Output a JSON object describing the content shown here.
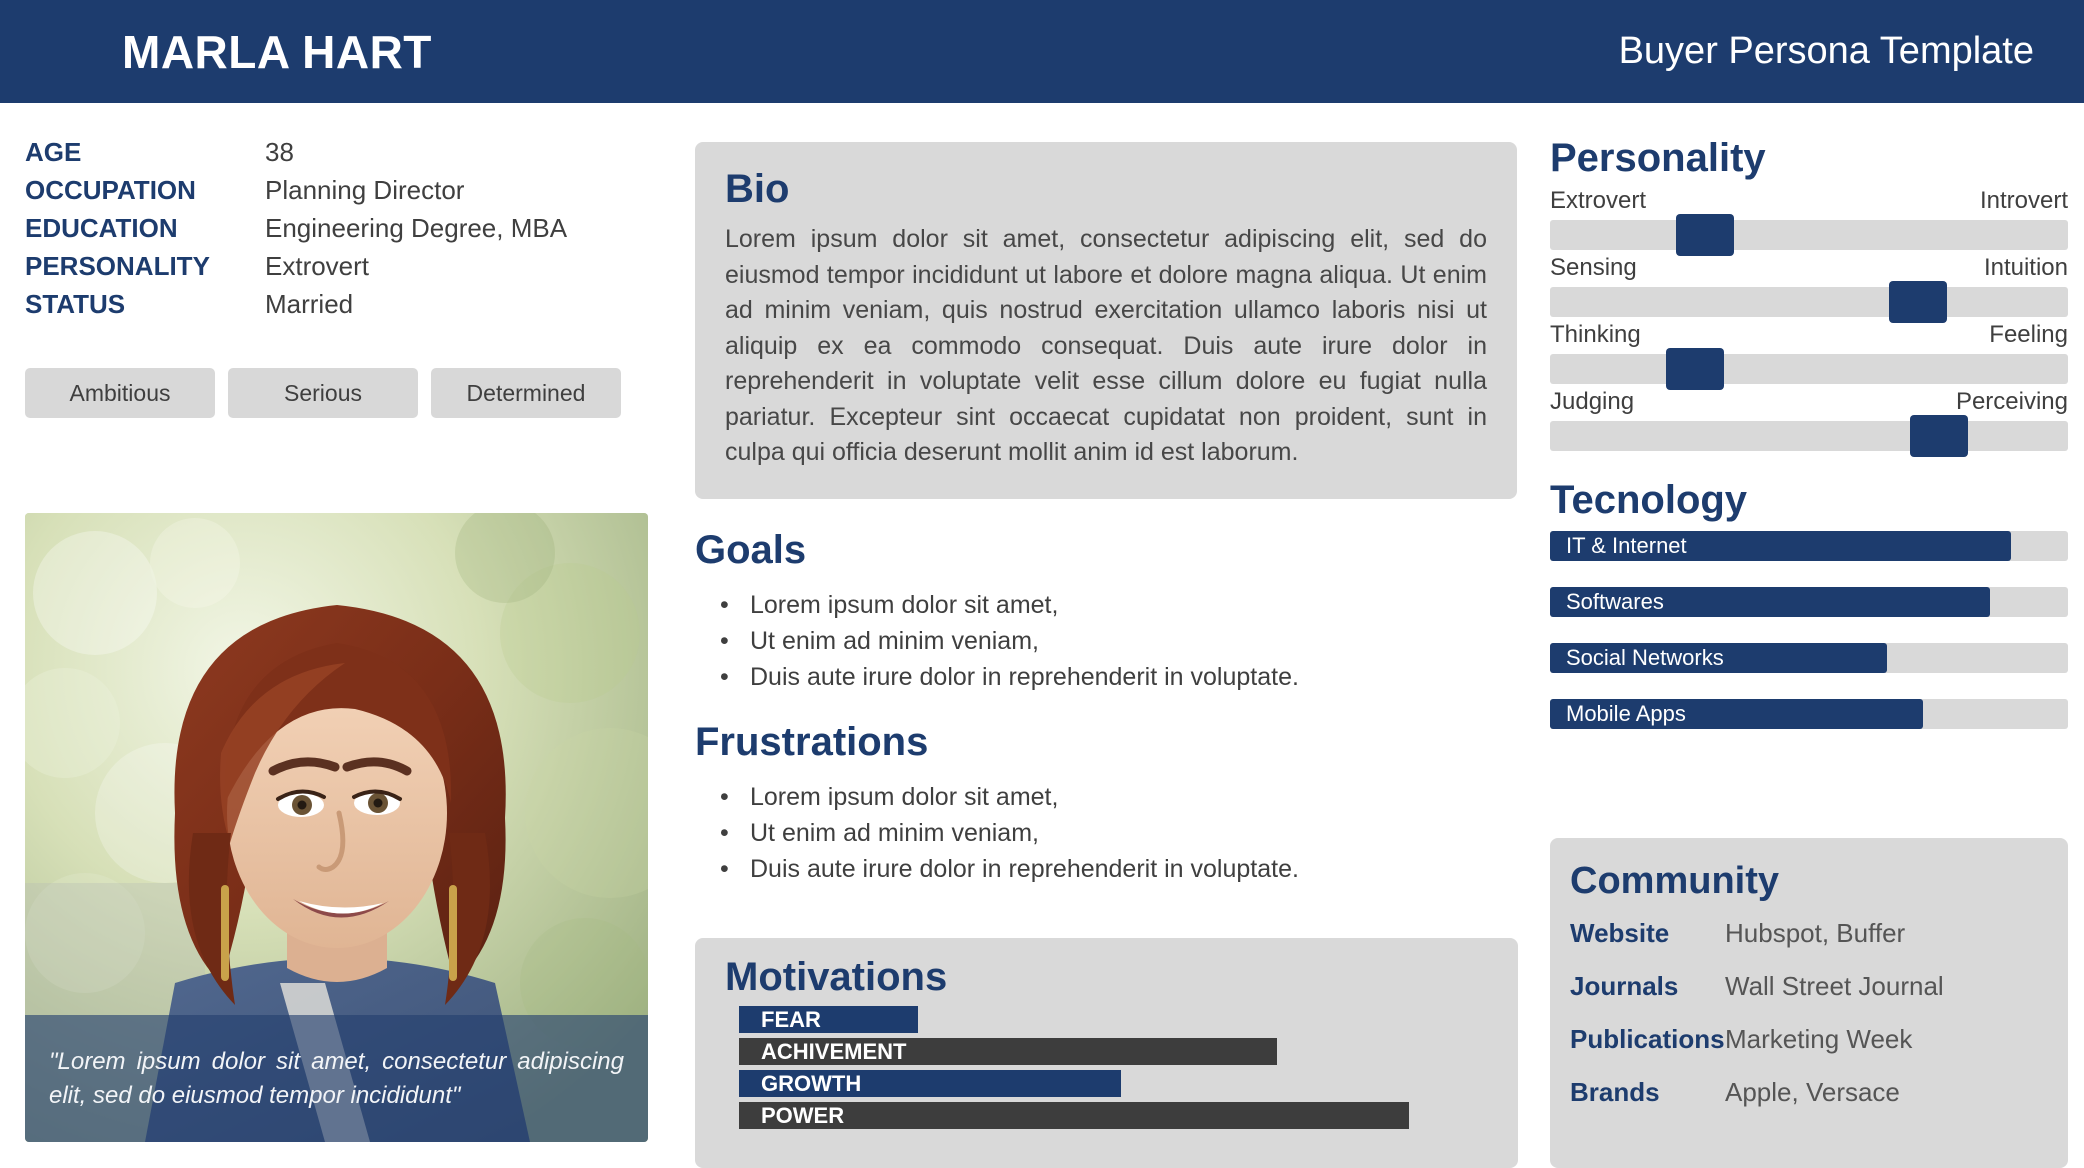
{
  "header": {
    "name": "MARLA HART",
    "template_label": "Buyer Persona Template"
  },
  "profile": {
    "facts": [
      {
        "label": "AGE",
        "value": "38"
      },
      {
        "label": "OCCUPATION",
        "value": "Planning Director"
      },
      {
        "label": "EDUCATION",
        "value": "Engineering Degree, MBA"
      },
      {
        "label": "PERSONALITY",
        "value": "Extrovert"
      },
      {
        "label": "STATUS",
        "value": "Married"
      }
    ],
    "traits": [
      "Ambitious",
      "Serious",
      "Determined"
    ],
    "quote": "\"Lorem ipsum dolor sit amet, consectetur adipiscing elit, sed do eiusmod tempor incididunt\""
  },
  "bio": {
    "title": "Bio",
    "body": "Lorem ipsum dolor sit amet, consectetur adipiscing elit, sed do eiusmod tempor incididunt ut labore et dolore magna aliqua. Ut enim ad minim veniam, quis nostrud exercitation ullamco laboris nisi ut aliquip ex ea commodo consequat. Duis aute irure dolor in reprehenderit in voluptate velit esse cillum dolore eu fugiat nulla pariatur. Excepteur sint occaecat cupidatat non proident, sunt in culpa qui officia deserunt mollit anim id est laborum."
  },
  "goals": {
    "title": "Goals",
    "items": [
      "Lorem ipsum dolor sit amet,",
      "Ut enim ad minim veniam,",
      "Duis aute irure dolor in reprehenderit in voluptate."
    ]
  },
  "frustrations": {
    "title": "Frustrations",
    "items": [
      "Lorem ipsum dolor sit amet,",
      "Ut enim ad minim veniam,",
      "Duis aute irure dolor in reprehenderit in voluptate."
    ]
  },
  "motivations": {
    "title": "Motivations",
    "items": [
      {
        "label": "FEAR",
        "percent": 23,
        "color": "#1d3c6e"
      },
      {
        "label": "ACHIVEMENT",
        "percent": 69,
        "color": "#3d3d3d"
      },
      {
        "label": "GROWTH",
        "percent": 49,
        "color": "#1d3c6e"
      },
      {
        "label": "POWER",
        "percent": 86,
        "color": "#3d3d3d"
      }
    ]
  },
  "personality": {
    "title": "Personality",
    "sliders": [
      {
        "left_label": "Extrovert",
        "right_label": "Introvert",
        "percent": 30
      },
      {
        "left_label": "Sensing",
        "right_label": "Intuition",
        "percent": 71
      },
      {
        "left_label": "Thinking",
        "right_label": "Feeling",
        "percent": 28
      },
      {
        "left_label": "Judging",
        "right_label": "Perceiving",
        "percent": 75
      }
    ]
  },
  "technology": {
    "title": "Tecnology",
    "items": [
      {
        "label": "IT & Internet",
        "percent": 89
      },
      {
        "label": "Softwares",
        "percent": 85
      },
      {
        "label": "Social Networks",
        "percent": 65
      },
      {
        "label": "Mobile Apps",
        "percent": 72
      }
    ]
  },
  "community": {
    "title": "Community",
    "rows": [
      {
        "key": "Website",
        "value": "Hubspot, Buffer"
      },
      {
        "key": "Journals",
        "value": "Wall Street Journal"
      },
      {
        "key": "Publications",
        "value": "Marketing Week"
      },
      {
        "key": "Brands",
        "value": "Apple, Versace"
      }
    ]
  },
  "colors": {
    "navy": "#1d3c6e",
    "panel_gray": "#d9d9d9",
    "bar_dark": "#3d3d3d",
    "text_gray": "#3f3f3f"
  }
}
